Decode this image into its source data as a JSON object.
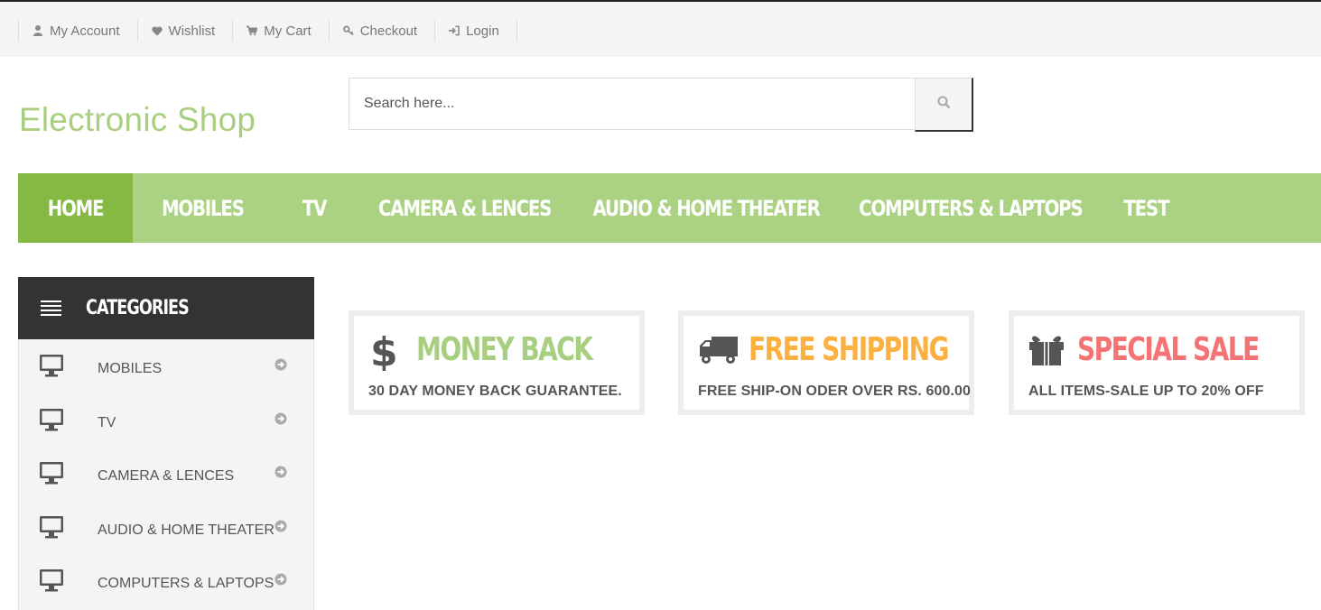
{
  "top_links": [
    {
      "label": "My Account",
      "icon": "user-icon"
    },
    {
      "label": "Wishlist",
      "icon": "heart-icon"
    },
    {
      "label": "My Cart",
      "icon": "cart-icon"
    },
    {
      "label": "Checkout",
      "icon": "key-icon"
    },
    {
      "label": "Login",
      "icon": "sign-in-icon"
    }
  ],
  "header": {
    "logo": "Electronic Shop",
    "search_placeholder": "Search here...",
    "search_icon": "search-icon"
  },
  "nav": {
    "items": [
      {
        "label": "HOME",
        "active": true
      },
      {
        "label": "MOBILES"
      },
      {
        "label": "TV"
      },
      {
        "label": "CAMERA & LENCES"
      },
      {
        "label": "AUDIO & HOME THEATER"
      },
      {
        "label": "COMPUTERS & LAPTOPS"
      },
      {
        "label": "TEST"
      }
    ]
  },
  "categories": {
    "title": "CATEGORIES",
    "items": [
      {
        "label": "MOBILES"
      },
      {
        "label": "TV"
      },
      {
        "label": "CAMERA & LENCES"
      },
      {
        "label": "AUDIO & HOME THEATER"
      },
      {
        "label": "COMPUTERS & LAPTOPS"
      }
    ]
  },
  "features": [
    {
      "icon": "dollar-icon",
      "title": "MONEY BACK",
      "subtitle": "30 DAY MONEY BACK GUARANTEE.",
      "color": "#a8cf80"
    },
    {
      "icon": "truck-icon",
      "title": "FREE SHIPPING",
      "subtitle": "FREE SHIP-ON ODER OVER RS. 600.00",
      "color": "#fbb040"
    },
    {
      "icon": "gift-icon",
      "title": "SPECIAL SALE",
      "subtitle": "ALL ITEMS-SALE UP TO 20% OFF",
      "color": "#f47374"
    }
  ],
  "colors": {
    "brand_green": "#a8cf80",
    "nav_green": "#abd283",
    "nav_active": "#86b944",
    "dark": "#333333"
  }
}
